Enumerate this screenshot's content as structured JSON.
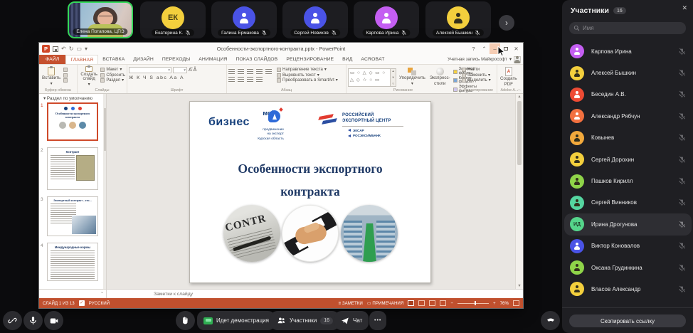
{
  "conference": {
    "tiles": [
      {
        "name": "Елена Потапова, ЦПЭ"
      },
      {
        "name": "Екатерина К.",
        "initials": "ЕК",
        "color": "#f3cf3d"
      },
      {
        "name": "Галина Ермакова",
        "color": "#4a53e6"
      },
      {
        "name": "Сергей Новиков",
        "color": "#4a53e6"
      },
      {
        "name": "Карпова Ирина",
        "color": "#c45ef2"
      },
      {
        "name": "Алексей Бышкин",
        "color": "#f3cf3d"
      }
    ],
    "next_tiles_icon": "›",
    "toolbar": {
      "sharing_label": "Идет демонстрация",
      "participants_label": "Участники",
      "participants_count": "16",
      "chat_label": "Чат",
      "more_label": "•••"
    }
  },
  "sidebar": {
    "title": "Участники",
    "count": "16",
    "close_icon": "✕",
    "search_placeholder": "Имя",
    "participants": [
      {
        "name": "Карпова Ирина",
        "color": "#c45ef2"
      },
      {
        "name": "Алексей Бышкин",
        "color": "#f3cf3d"
      },
      {
        "name": "Беседин А.В.",
        "color": "#ee4b34"
      },
      {
        "name": "Александр Рябчун",
        "color": "#f2703f"
      },
      {
        "name": "Ковынев",
        "color": "#f2a93c"
      },
      {
        "name": "Сергей Дорохин",
        "color": "#f3cf3d"
      },
      {
        "name": "Пашков Кирилл",
        "color": "#8fd449"
      },
      {
        "name": "Сергей Винников",
        "color": "#55d5a0"
      },
      {
        "name": "Ирина Дрогунова",
        "initials": "ИД",
        "color": "#55d58b"
      },
      {
        "name": "Виктор Коновалов",
        "color": "#4a53e6"
      },
      {
        "name": "Оксана Грудинкина",
        "color": "#8fd449"
      },
      {
        "name": "Власов Александр",
        "color": "#f3cf3d"
      }
    ],
    "copy_link_label": "Скопировать ссылку"
  },
  "powerpoint": {
    "logo_letter": "P",
    "window_title": "Особенности-экспортного-контракта.pptx - PowerPoint",
    "help_icon": "?",
    "account_label": "Учетная запись Майкрософт",
    "tabs": [
      "ФАЙЛ",
      "ГЛАВНАЯ",
      "ВСТАВКА",
      "ДИЗАЙН",
      "ПЕРЕХОДЫ",
      "АНИМАЦИЯ",
      "ПОКАЗ СЛАЙДОВ",
      "РЕЦЕНЗИРОВАНИЕ",
      "ВИД",
      "ACROBAT"
    ],
    "ribbon": {
      "paste": "Вставить",
      "clipboard_group": "Буфер обмена",
      "new_slide": "Создать слайд",
      "layout": "Макет",
      "reset": "Сбросить",
      "section": "Раздел",
      "slides_group": "Слайды",
      "font_letters": "Ж К Ч S abc Aa А",
      "font_group": "Шрифт",
      "text_direction": "Направление текста",
      "align_text": "Выровнять текст",
      "smartart": "Преобразовать в SmartArt",
      "paragraph_group": "Абзац",
      "shapes_row1": "▭ ○ △ ◇ ▭ ○",
      "shapes_row2": "△ ◇ ☆ ○ ▭",
      "arrange": "Упорядочить",
      "quick_styles_1": "Экспресс-",
      "quick_styles_2": "стили",
      "shape_fill": "Заливка фигуры",
      "shape_outline": "Контур фигуры",
      "shape_effects": "Эффекты фигуры",
      "drawing_group": "Рисование",
      "find": "Найти",
      "replace": "Заменить",
      "select": "Выделить",
      "editing_group": "Редактирование",
      "create_pdf_1": "Создать",
      "create_pdf_2": "PDF",
      "adobe_group": "Adobe A..."
    },
    "thumbnails": {
      "section_label": "Раздел по умолчанию",
      "slide1_num": "1",
      "slide2_num": "2",
      "slide3_num": "3",
      "slide4_num": "4",
      "slide2_title": "Контракт",
      "slide3_title": "Экспортный контракт - это...",
      "slide4_title": "Международные нормы"
    },
    "slide": {
      "logo_my": "мой",
      "logo_business": "бизнес",
      "logo_sub1": "продвижение",
      "logo_sub2": "на экспорт",
      "logo_sub3": "Курская область",
      "rec_line1": "РОССИЙСКИЙ",
      "rec_line2": "ЭКСПОРТНЫЙ ЦЕНТР",
      "rec_sub1": "ЭКСАР",
      "rec_sub2": "РОСЭКСИМБАНК",
      "title_line1": "Особенности экспортного",
      "title_line2": "контракта",
      "circle1_text": "CONTR"
    },
    "notes_placeholder": "Заметки к слайду",
    "status": {
      "slide_counter": "СЛАЙД 1 ИЗ 13",
      "language": "РУССКИЙ",
      "notes": "ЗАМЕТКИ",
      "comments": "ПРИМЕЧАНИЯ",
      "zoom_level": "76%"
    }
  }
}
